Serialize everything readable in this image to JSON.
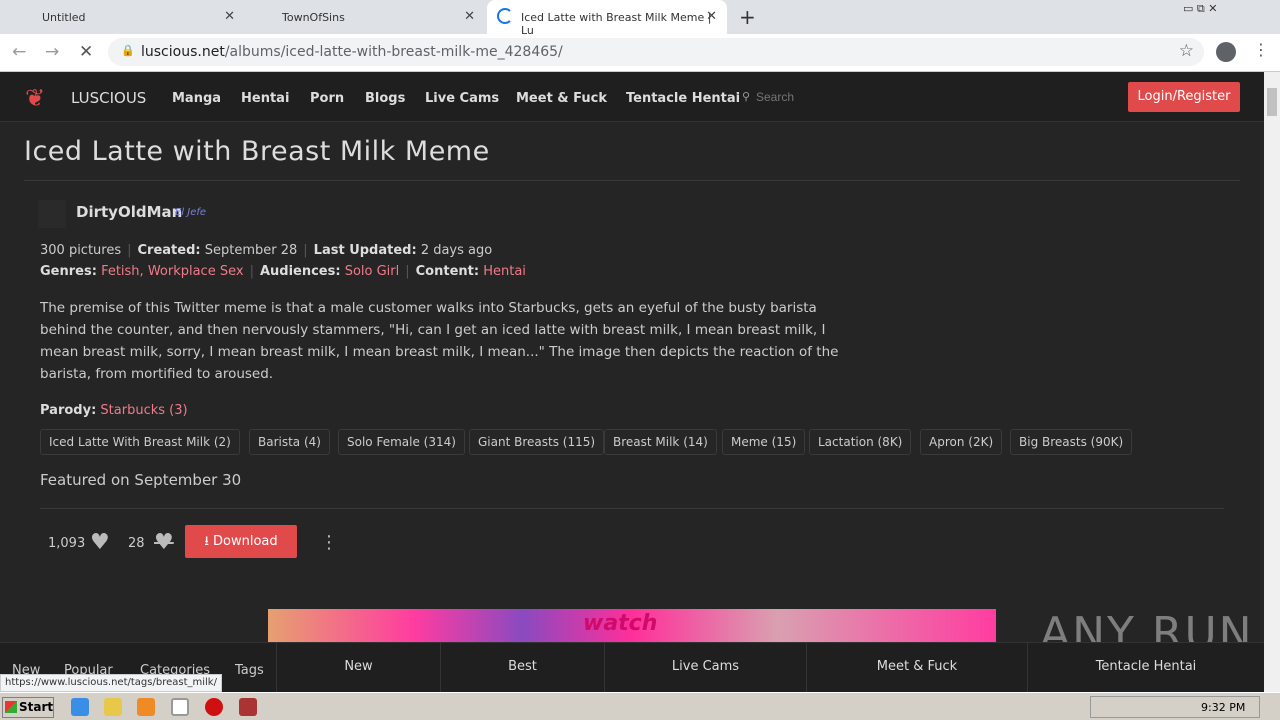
{
  "browser": {
    "tabs": [
      {
        "title": "Untitled"
      },
      {
        "title": "TownOfSins"
      },
      {
        "title": "Iced Latte with Breast Milk Meme | Lu"
      }
    ],
    "url_domain": "luscious.net",
    "url_path": "/albums/iced-latte-with-breast-milk-me_428465/",
    "status_url": "https://www.luscious.net/tags/breast_milk/"
  },
  "site": {
    "logo": "LUSCIOUS",
    "nav": [
      "Manga",
      "Hentai",
      "Porn",
      "Blogs",
      "Live Cams",
      "Meet & Fuck",
      "Tentacle Hentai"
    ],
    "search_placeholder": "Search",
    "login": "Login/Register",
    "accent": "#e04a4a"
  },
  "album": {
    "title": "Iced Latte with Breast Milk Meme",
    "author": "DirtyOldMan",
    "author_badge": "El Jefe",
    "pictures": "300 pictures",
    "created_label": "Created:",
    "created": "September 28",
    "updated_label": "Last Updated:",
    "updated": "2 days ago",
    "genres_label": "Genres:",
    "genres": "Fetish, Workplace Sex",
    "audiences_label": "Audiences:",
    "audiences": "Solo Girl",
    "content_label": "Content:",
    "content": "Hentai",
    "description": "The premise of this Twitter meme is that a male customer walks into Starbucks, gets an eyeful of the busty barista behind the counter, and then nervously stammers, \"Hi, can I get an iced latte with breast milk, I mean breast milk, I mean breast milk, sorry, I mean breast milk, I mean breast milk, I mean...\" The image then depicts the reaction of the barista, from mortified to aroused.",
    "parody_label": "Parody:",
    "parody": "Starbucks (3)",
    "tags": [
      "Iced Latte With Breast Milk (2)",
      "Barista (4)",
      "Solo Female (314)",
      "Giant Breasts (115)",
      "Breast Milk (14)",
      "Meme (15)",
      "Lactation (8K)",
      "Apron (2K)",
      "Big Breasts (90K)"
    ],
    "featured": "Featured on September 30",
    "likes": "1,093",
    "dislikes": "28",
    "download": "Download"
  },
  "banner_text": "watch",
  "bottom_nav": {
    "left": [
      "New",
      "Popular",
      "Categories",
      "Tags"
    ],
    "tabs": [
      "New",
      "Best",
      "Live Cams",
      "Meet & Fuck",
      "Tentacle Hentai"
    ]
  },
  "taskbar": {
    "start": "Start",
    "clock": "9:32 PM"
  },
  "watermark": "ANY RUN"
}
